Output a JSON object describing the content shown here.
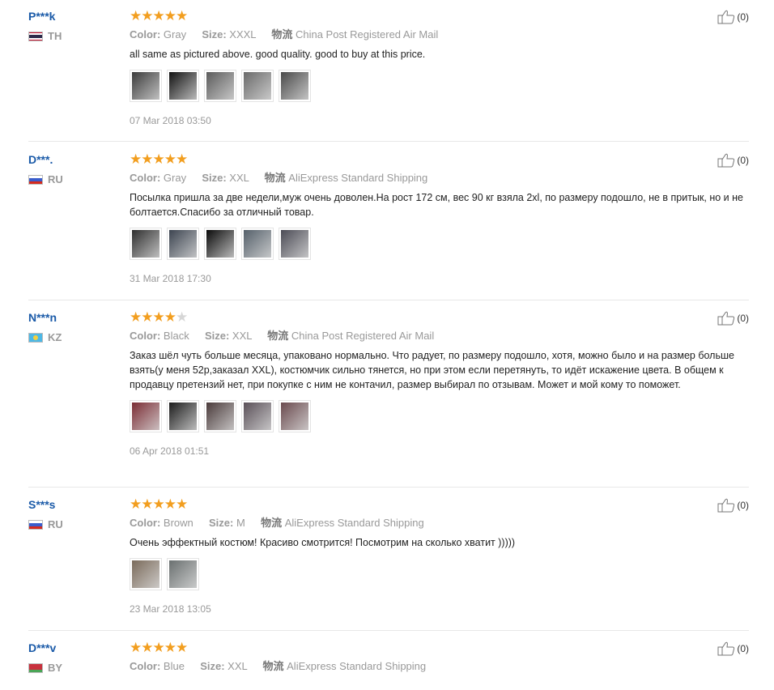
{
  "reviews": [
    {
      "user": "P***k",
      "country": "TH",
      "flag": "th",
      "rating": 5,
      "color_label": "Color:",
      "color": "Gray",
      "size_label": "Size:",
      "size": "XXXL",
      "ship_label": "物流",
      "shipping": "China Post Registered Air Mail",
      "text": "all same as pictured above. good quality. good to buy at this price.",
      "photos": [
        "#3a3a3a",
        "#111111",
        "#5b5b5b",
        "#6a6a6a",
        "#4a4a4a"
      ],
      "date": "07 Mar 2018 03:50",
      "likes": "(0)"
    },
    {
      "user": "D***.",
      "country": "RU",
      "flag": "ru",
      "rating": 5,
      "color_label": "Color:",
      "color": "Gray",
      "size_label": "Size:",
      "size": "XXL",
      "ship_label": "物流",
      "shipping": "AliExpress Standard Shipping",
      "text": "Посылка пришла за две недели,муж очень доволен.На рост 172 см, вес 90 кг взяла 2xl, по размеру подошло, не в притык, но и не болтается.Спасибо за отличный товар.",
      "photos": [
        "#2e2e2e",
        "#3c4450",
        "#0a0a0a",
        "#55606a",
        "#4b4b55"
      ],
      "date": "31 Mar 2018 17:30",
      "likes": "(0)"
    },
    {
      "user": "N***n",
      "country": "KZ",
      "flag": "kz",
      "rating": 4,
      "color_label": "Color:",
      "color": "Black",
      "size_label": "Size:",
      "size": "XXL",
      "ship_label": "物流",
      "shipping": "China Post Registered Air Mail",
      "text": "Заказ шёл чуть больше месяца, упаковано нормально. Что радует, по размеру подошло, хотя, можно было и на размер больше взять(у меня 52р,заказал XXL), костюмчик сильно тянется, но при этом если перетянуть, то идёт искажение цвета. В общем к продавцу претензий нет, при покупке с ним не контачил, размер выбирал по отзывам. Может и мой кому то поможет.",
      "photos": [
        "#7a2c34",
        "#1c1c1c",
        "#4a3a3a",
        "#5a5058",
        "#6a4a4e"
      ],
      "date": "06 Apr 2018 01:51",
      "likes": "(0)"
    },
    {
      "user": "S***s",
      "country": "RU",
      "flag": "ru",
      "rating": 5,
      "color_label": "Color:",
      "color": "Brown",
      "size_label": "Size:",
      "size": "M",
      "ship_label": "物流",
      "shipping": "AliExpress Standard Shipping",
      "text": "Очень эффектный костюм! Красиво смотрится! Посмотрим на сколько хватит )))))",
      "photos": [
        "#7a6a5a",
        "#6a7070"
      ],
      "date": "23 Mar 2018 13:05",
      "likes": "(0)"
    },
    {
      "user": "D***v",
      "country": "BY",
      "flag": "by",
      "rating": 5,
      "color_label": "Color:",
      "color": "Blue",
      "size_label": "Size:",
      "size": "XXL",
      "ship_label": "物流",
      "shipping": "AliExpress Standard Shipping",
      "text": "",
      "photos": [],
      "date": "",
      "likes": "(0)"
    }
  ],
  "icons": {
    "like": "thumbs-up-icon"
  }
}
